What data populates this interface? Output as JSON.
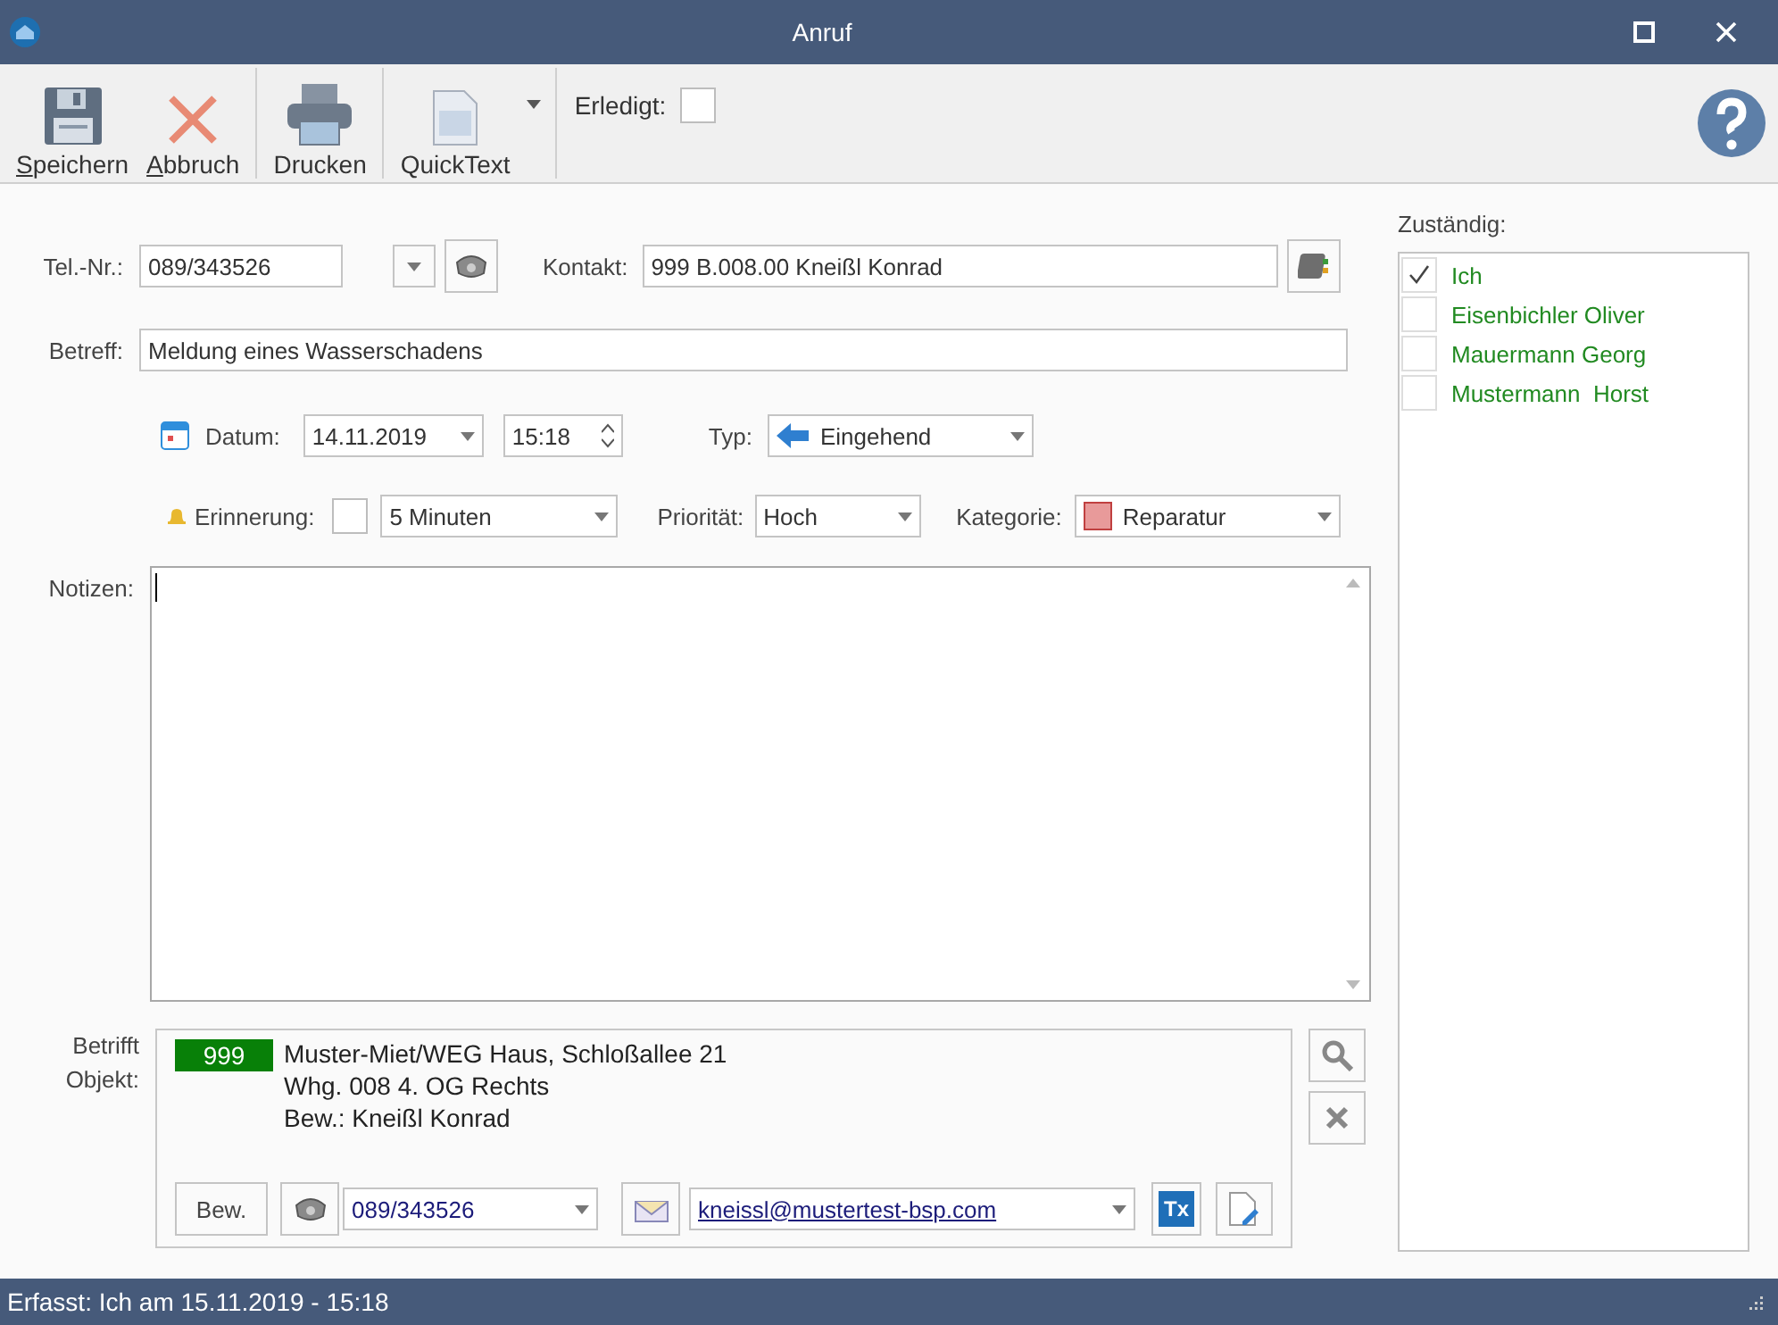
{
  "window": {
    "title": "Anruf"
  },
  "toolbar": {
    "buttons": [
      {
        "kind": "save",
        "label": "Speichern",
        "mnemonic": true
      },
      {
        "kind": "cancel",
        "label": "Abbruch",
        "mnemonic": true
      },
      {
        "kind": "print",
        "label": "Drucken",
        "mnemonic": false
      },
      {
        "kind": "quicktext",
        "label": "QuickText",
        "mnemonic": false
      }
    ],
    "done": {
      "label": "Erledigt:",
      "checked": false
    }
  },
  "form": {
    "phone": {
      "label": "Tel.-Nr.:",
      "value": "089/343526"
    },
    "contact": {
      "label": "Kontakt:",
      "value": "999 B.008.00 Kneißl Konrad"
    },
    "subject": {
      "label": "Betreff:",
      "value": "Meldung eines Wasserschadens"
    },
    "date": {
      "label": "Datum:",
      "value": "14.11.2019"
    },
    "time": {
      "value": "15:18"
    },
    "type": {
      "label": "Typ:",
      "value": "Eingehend"
    },
    "reminder": {
      "label": "Erinnerung:",
      "checked": false,
      "value": "5 Minuten"
    },
    "priority": {
      "label": "Priorität:",
      "value": "Hoch"
    },
    "category": {
      "label": "Kategorie:",
      "value": "Reparatur"
    },
    "notes": {
      "label": "Notizen:"
    }
  },
  "object": {
    "label": "Betrifft Objekt:",
    "number": "999",
    "lines": [
      "Muster-Miet/WEG Haus, Schloßallee 21",
      "Whg. 008 4. OG Rechts",
      "Bew.: Kneißl Konrad"
    ],
    "tenant_button": "Bew.",
    "phone": "089/343526",
    "email": "kneissl@mustertest-bsp.com",
    "tx_button": "Tx"
  },
  "assignees": {
    "label": "Zuständig:",
    "items": [
      {
        "name": "Ich",
        "checked": true
      },
      {
        "name": "Eisenbichler Oliver",
        "checked": false
      },
      {
        "name": "Mauermann Georg",
        "checked": false
      },
      {
        "name": "Mustermann  Horst",
        "checked": false
      }
    ]
  },
  "status_bar": {
    "text": "Erfasst: Ich am 15.11.2019 - 15:18"
  }
}
